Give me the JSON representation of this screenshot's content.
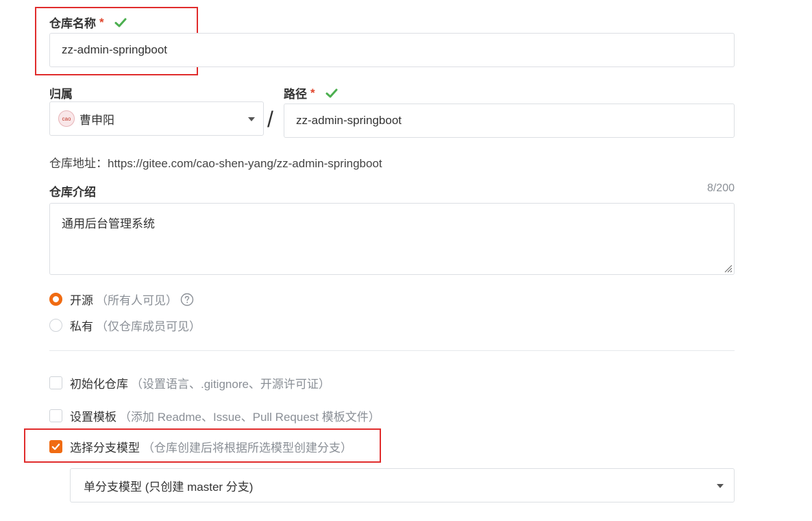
{
  "repo_name": {
    "label": "仓库名称",
    "required_mark": "*",
    "value": "zz-admin-springboot"
  },
  "owner": {
    "label": "归属",
    "value": "曹申阳",
    "avatar_text": "cao"
  },
  "separator": "/",
  "path": {
    "label": "路径",
    "required_mark": "*",
    "value": "zz-admin-springboot"
  },
  "repo_url": {
    "text": "仓库地址：https://gitee.com/cao-shen-yang/zz-admin-springboot"
  },
  "description": {
    "label": "仓库介绍",
    "counter": "8/200",
    "value": "通用后台管理系统"
  },
  "visibility": {
    "options": [
      {
        "label": "开源",
        "hint": "（所有人可见）",
        "selected": true,
        "help_icon": "question-circle-icon"
      },
      {
        "label": "私有",
        "hint": "（仅仓库成员可见）",
        "selected": false
      }
    ]
  },
  "init_options": [
    {
      "label": "初始化仓库",
      "hint": "（设置语言、.gitignore、开源许可证）",
      "checked": false
    },
    {
      "label": "设置模板",
      "hint": "（添加 Readme、Issue、Pull Request 模板文件）",
      "checked": false
    },
    {
      "label": "选择分支模型",
      "hint": "（仓库创建后将根据所选模型创建分支）",
      "checked": true
    }
  ],
  "branch_model": {
    "selected": "单分支模型 (只创建 master 分支)"
  },
  "colors": {
    "accent": "#f06b12",
    "success": "#4caf50",
    "required": "#e0452c",
    "highlight_box": "#e02c2c"
  }
}
